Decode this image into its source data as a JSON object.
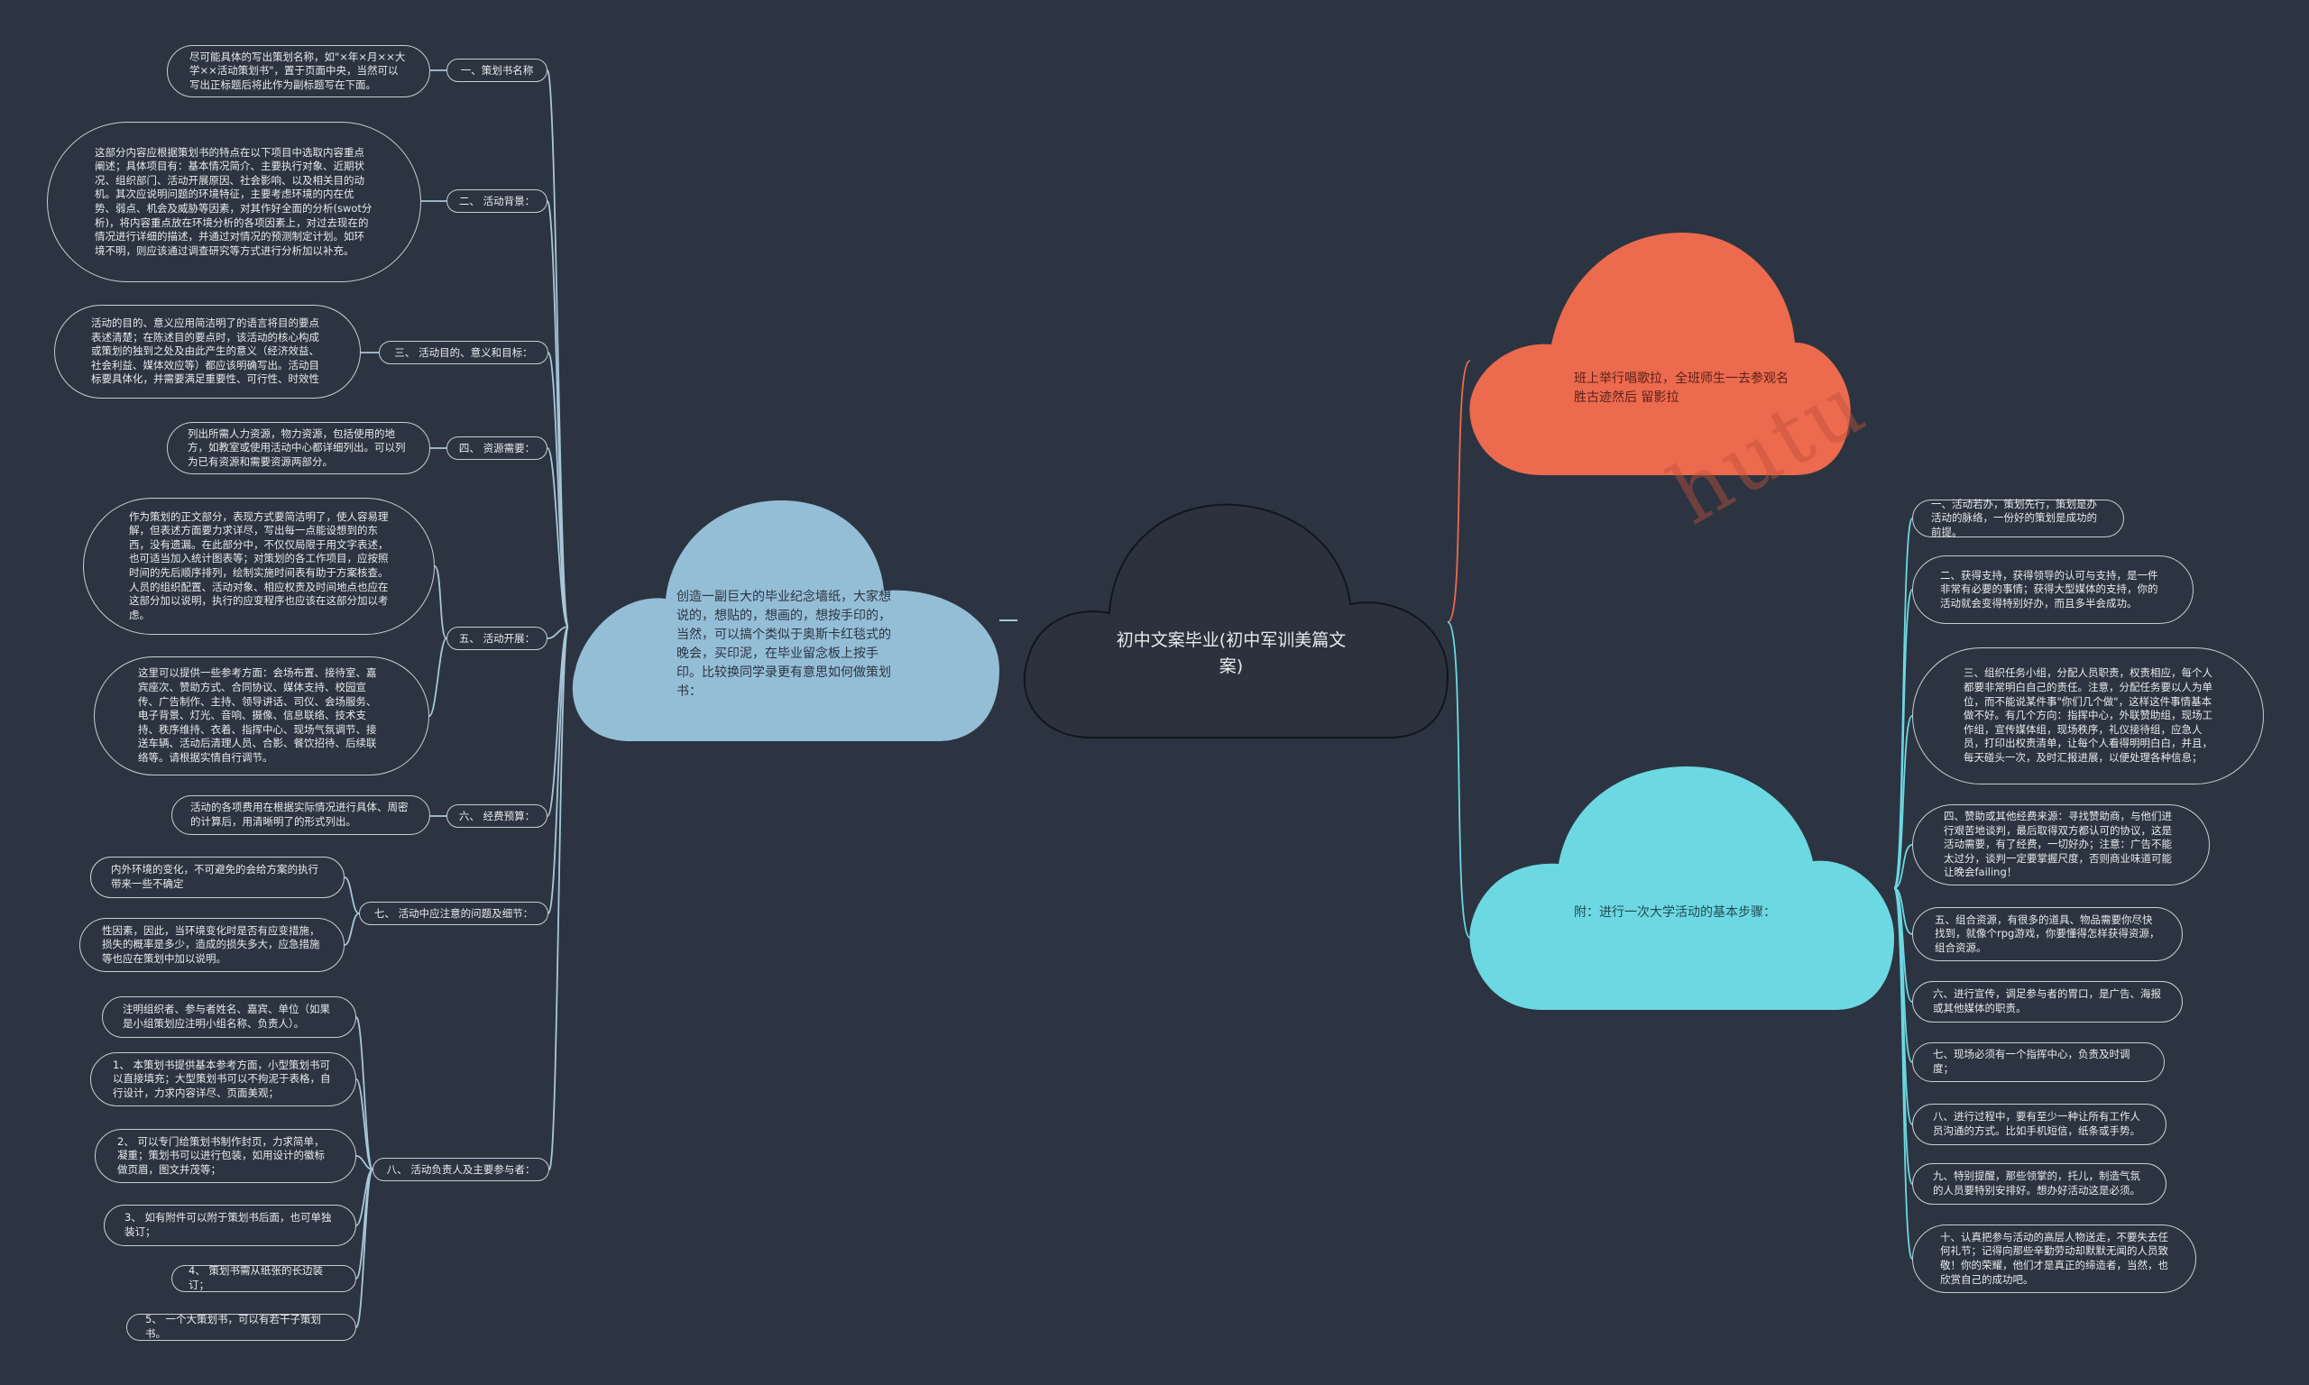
{
  "center": {
    "title": "初中文案毕业(初中军训美篇文案)"
  },
  "left_cloud": {
    "text": "创造一副巨大的毕业纪念墙纸，大家想说的，想贴的，想画的，想按手印的，当然，可以搞个类似于奥斯卡红毯式的晚会，买印泥，在毕业留念板上按手印。比较换同学录更有意思如何做策划书："
  },
  "orange_cloud": {
    "text": "班上举行唱歌拉，全班师生一去参观名胜古迹然后  留影拉"
  },
  "cyan_cloud": {
    "text": "附：进行一次大学活动的基本步骤："
  },
  "watermark": "hutu",
  "left_sections": [
    {
      "label": "一、策划书名称",
      "notes": [
        "尽可能具体的写出策划名称，如\"×年×月××大学××活动策划书\"，置于页面中央，当然可以写出正标题后将此作为副标题写在下面。"
      ]
    },
    {
      "label": "二、 活动背景：",
      "notes": [
        "这部分内容应根据策划书的特点在以下项目中选取内容重点阐述；具体项目有：基本情况简介、主要执行对象、近期状况、组织部门、活动开展原因、社会影响、以及相关目的动机。其次应说明问题的环境特征，主要考虑环境的内在优势、弱点、机会及威胁等因素，对其作好全面的分析(swot分析)，将内容重点放在环境分析的各项因素上，对过去现在的情况进行详细的描述，并通过对情况的预测制定计划。如环境不明，则应该通过调查研究等方式进行分析加以补充。"
      ]
    },
    {
      "label": "三、 活动目的、意义和目标：",
      "notes": [
        "活动的目的、意义应用简洁明了的语言将目的要点表述清楚；在陈述目的要点时，该活动的核心构成或策划的独到之处及由此产生的意义（经济效益、社会利益、媒体效应等）都应该明确写出。活动目标要具体化，并需要满足重要性、可行性、时效性"
      ]
    },
    {
      "label": "四、 资源需要：",
      "notes": [
        "列出所需人力资源，物力资源，包括使用的地方，如教室或使用活动中心都详细列出。可以列为已有资源和需要资源两部分。"
      ]
    },
    {
      "label": "五、 活动开展：",
      "notes": [
        "作为策划的正文部分，表现方式要简洁明了，使人容易理解，但表述方面要力求详尽，写出每一点能设想到的东西，没有遗漏。在此部分中，不仅仅局限于用文字表述，也可适当加入统计图表等；对策划的各工作项目，应按照时间的先后顺序排列，绘制实施时间表有助于方案核查。人员的组织配置、活动对象、相应权责及时间地点也应在这部分加以说明，执行的应变程序也应该在这部分加以考虑。",
        "这里可以提供一些参考方面：会场布置、接待室、嘉宾座次、赞助方式、合同协议、媒体支持、校园宣传、广告制作、主持、领导讲话、司仪、会场服务、电子背景、灯光、音响、摄像、信息联络、技术支持、秩序维持、衣着、指挥中心、现场气氛调节、接送车辆、活动后清理人员、合影、餐饮招待、后续联络等。请根据实情自行调节。"
      ]
    },
    {
      "label": "六、 经费预算：",
      "notes": [
        "活动的各项费用在根据实际情况进行具体、周密的计算后，用清晰明了的形式列出。"
      ]
    },
    {
      "label": "七、 活动中应注意的问题及细节：",
      "notes": [
        "内外环境的变化，不可避免的会给方案的执行带来一些不确定",
        "性因素，因此，当环境变化时是否有应变措施，损失的概率是多少，造成的损失多大，应急措施等也应在策划中加以说明。"
      ]
    },
    {
      "label": "八、 活动负责人及主要参与者：",
      "notes": [
        "注明组织者、参与者姓名、嘉宾、单位（如果是小组策划应注明小组名称、负责人）。",
        "1、 本策划书提供基本参考方面，小型策划书可以直接填充；大型策划书可以不拘泥于表格，自行设计，力求内容详尽、页面美观；",
        "2、 可以专门给策划书制作封页，力求简单，凝重；策划书可以进行包装，如用设计的徽标做页眉，图文并茂等；",
        "3、 如有附件可以附于策划书后面，也可单独装订；",
        "4、 策划书需从纸张的长边装订；",
        "5、 一个大策划书，可以有若干子策划书。"
      ]
    }
  ],
  "right_notes": [
    "一、活动若办，策划先行，策划是办活动的脉络，一份好的策划是成功的前提。",
    "二、获得支持，获得领导的认可与支持，是一件非常有必要的事情；获得大型媒体的支持，你的活动就会变得特别好办，而且多半会成功。",
    "三、组织任务小组，分配人员职责，权责相应，每个人都要非常明白自己的责任。注意，分配任务要以人为单位，而不能说某件事\"你们几个做\"，这样这件事情基本做不好。有几个方向：指挥中心，外联赞助组，现场工作组，宣传媒体组，现场秩序，礼仪接待组，应急人员，打印出权责清单，让每个人看得明明白白，并且，每天碰头一次，及时汇报进展，以便处理各种信息；",
    "四、赞助或其他经费来源：寻找赞助商，与他们进行艰苦地谈判，最后取得双方都认可的协议，这是活动需要，有了经费，一切好办；注意：广告不能太过分，谈判一定要掌握尺度，否则商业味道可能让晚会failing！",
    "五、组合资源，有很多的道具、物品需要你尽快找到，就像个rpg游戏，你要懂得怎样获得资源，组合资源。",
    "六、进行宣传，调足参与者的胃口，是广告、海报或其他媒体的职责。",
    "七、现场必须有一个指挥中心，负责及时调度；",
    "八、进行过程中，要有至少一种让所有工作人员沟通的方式。比如手机短信，纸条或手势。",
    "九、特别提醒，那些领掌的，托儿，制造气氛的人员要特别安排好。想办好活动这是必须。",
    "十、认真把参与活动的高层人物送走，不要失去任何礼节；记得向那些辛勤劳动却默默无闻的人员致敬！你的荣耀，他们才是真正的缔造者，当然，也欣赏自己的成功吧。"
  ],
  "colors": {
    "background": "#2c3441",
    "center_fill": "#2b323e",
    "blue_cloud": "#94bed6",
    "orange_cloud": "#ec6a4e",
    "cyan_cloud": "#6cd8e2",
    "line_blue": "#a9c6d8",
    "line_orange": "#ec6a4e",
    "line_cyan": "#6cd8e2"
  }
}
